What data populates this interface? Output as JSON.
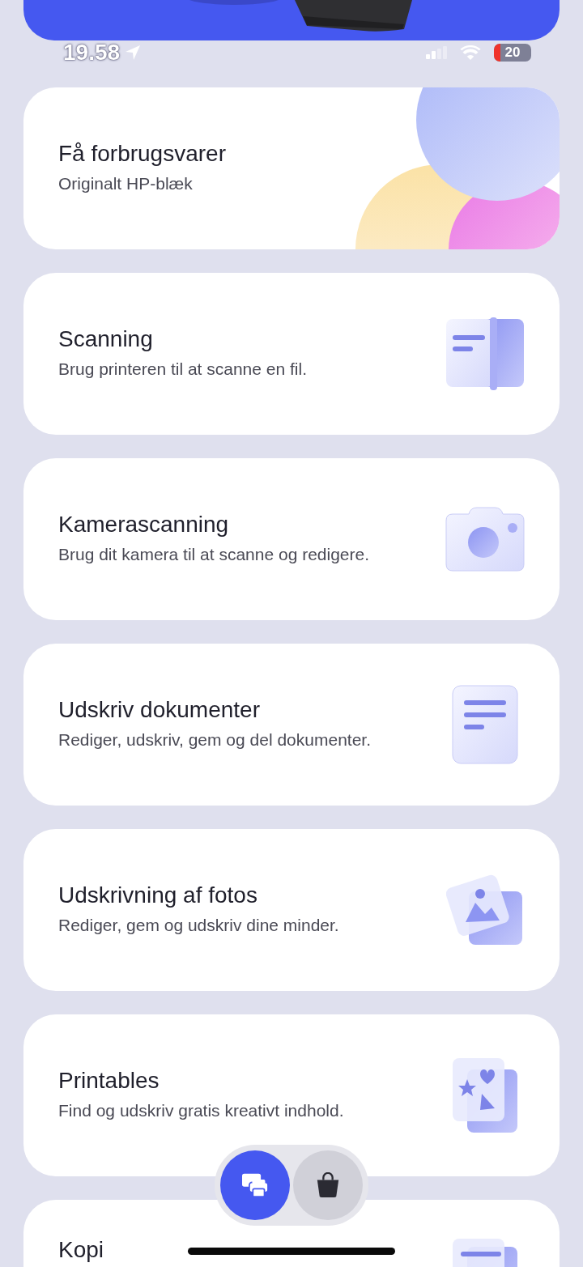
{
  "status_bar": {
    "time": "19.58",
    "battery": "20"
  },
  "cards": [
    {
      "title": "Få forbrugsvarer",
      "subtitle": "Originalt HP-blæk",
      "kind": "supplies"
    },
    {
      "title": "Scanning",
      "subtitle": "Brug printeren til at scanne en fil.",
      "kind": "scan"
    },
    {
      "title": "Kamerascanning",
      "subtitle": "Brug dit kamera til at scanne og redigere.",
      "kind": "camera"
    },
    {
      "title": "Udskriv dokumenter",
      "subtitle": "Rediger, udskriv, gem og del dokumenter.",
      "kind": "document"
    },
    {
      "title": "Udskrivning af fotos",
      "subtitle": "Rediger, gem og udskriv dine minder."
    },
    {
      "title": "Printables",
      "subtitle": "Find og udskriv gratis kreativt indhold.",
      "kind": "printables"
    },
    {
      "title": "Kopi",
      "kind": "copy"
    }
  ],
  "nav": [
    {
      "kind": "printer",
      "selected": true
    },
    {
      "kind": "bag",
      "selected": false
    }
  ]
}
